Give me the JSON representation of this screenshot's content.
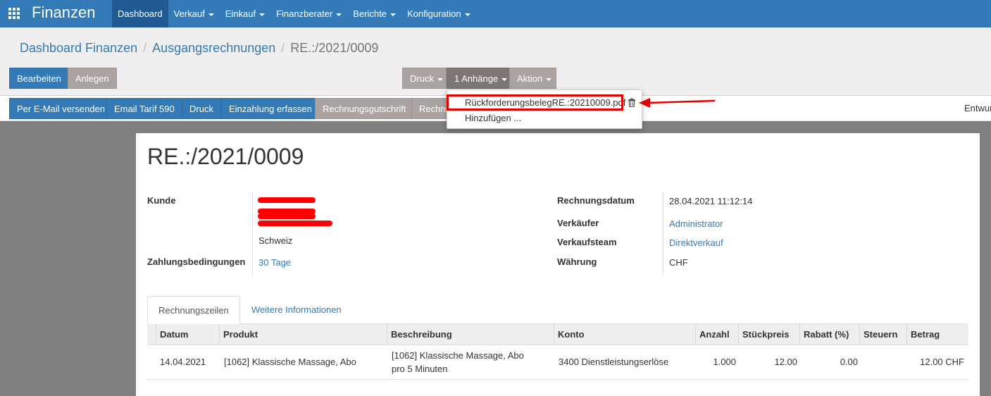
{
  "navbar": {
    "brand": "Finanzen",
    "menu": [
      {
        "label": "Dashboard",
        "active": true
      },
      {
        "label": "Verkauf",
        "caret": true
      },
      {
        "label": "Einkauf",
        "caret": true
      },
      {
        "label": "Finanzberater",
        "caret": true
      },
      {
        "label": "Berichte",
        "caret": true
      },
      {
        "label": "Konfiguration",
        "caret": true
      }
    ]
  },
  "breadcrumb": {
    "item1": "Dashboard Finanzen",
    "item2": "Ausgangsrechnungen",
    "current": "RE.:/2021/0009",
    "sep": "/"
  },
  "buttons": {
    "edit": "Bearbeiten",
    "create": "Anlegen",
    "print_menu": "Druck",
    "attachments_menu": "1 Anhänge",
    "action_menu": "Aktion"
  },
  "statusbar": {
    "send_email": "Per E-Mail versenden",
    "email_tarif": "Email Tarif 590",
    "print": "Druck",
    "register_payment": "Einzahlung erfassen",
    "credit_note": "Rechnungsgutschrift",
    "truncated_button": "Rechnu",
    "state": "Entwur"
  },
  "attachments_dropdown": {
    "file": "RückforderungsbelegRE.:20210009.pdf",
    "add": "Hinzufügen ..."
  },
  "invoice": {
    "title": "RE.:/2021/0009",
    "customer_label": "Kunde",
    "customer_country": "Schweiz",
    "payment_terms_label": "Zahlungsbedingungen",
    "payment_terms": "30 Tage",
    "invoice_date_label": "Rechnungsdatum",
    "invoice_date": "28.04.2021 11:12:14",
    "salesperson_label": "Verkäufer",
    "salesperson": "Administrator",
    "sales_team_label": "Verkaufsteam",
    "sales_team": "Direktverkauf",
    "currency_label": "Währung",
    "currency": "CHF"
  },
  "tabs": {
    "lines": "Rechnungszeilen",
    "more_info": "Weitere Informationen"
  },
  "table": {
    "headers": [
      "Datum",
      "Produkt",
      "Beschreibung",
      "Konto",
      "Anzahl",
      "Stückpreis",
      "Rabatt (%)",
      "Steuern",
      "Betrag"
    ],
    "rows": [
      {
        "date": "14.04.2021",
        "product": "[1062] Klassische Massage, Abo",
        "description_line1": "[1062] Klassische Massage, Abo",
        "description_line2": "pro 5 Minuten",
        "account": "3400 Dienstleistungserlöse",
        "quantity": "1.000",
        "unit_price": "12.00",
        "discount": "0.00",
        "taxes": "",
        "amount": "12.00 CHF"
      }
    ]
  },
  "colors": {
    "primary": "#337ab7",
    "navbar_active": "#1f5b92",
    "secondary_button": "#aaa39f",
    "annotation_red": "#e00000"
  }
}
